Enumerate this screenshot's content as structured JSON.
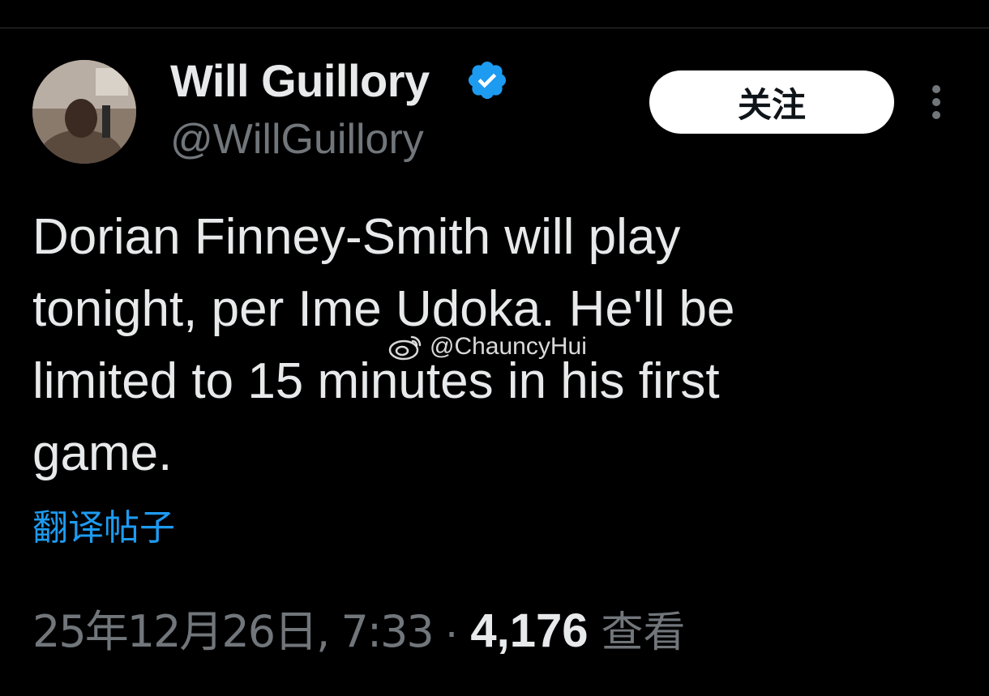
{
  "author": {
    "display_name": "Will Guillory",
    "handle": "@WillGuillory",
    "verified": true,
    "verified_icon": "verified-badge-icon"
  },
  "follow_button": {
    "label": "关注"
  },
  "more_menu": {
    "icon": "more-vertical-icon"
  },
  "tweet": {
    "text": "Dorian Finney-Smith will play\ntonight, per Ime Udoka. He'll be\nlimited to 15 minutes in his first\ngame.",
    "translate_label": "翻译帖子"
  },
  "watermark": {
    "icon": "weibo-icon",
    "text": "@ChauncyHui"
  },
  "meta": {
    "date": "25年12月26日, 7:33",
    "separator": "·",
    "views": "4,176",
    "views_label": "查看"
  },
  "colors": {
    "background": "#000000",
    "primary_text": "#e7e9ea",
    "secondary_text": "#71767b",
    "link": "#1d9bf0",
    "verified": "#1d9bf0"
  }
}
